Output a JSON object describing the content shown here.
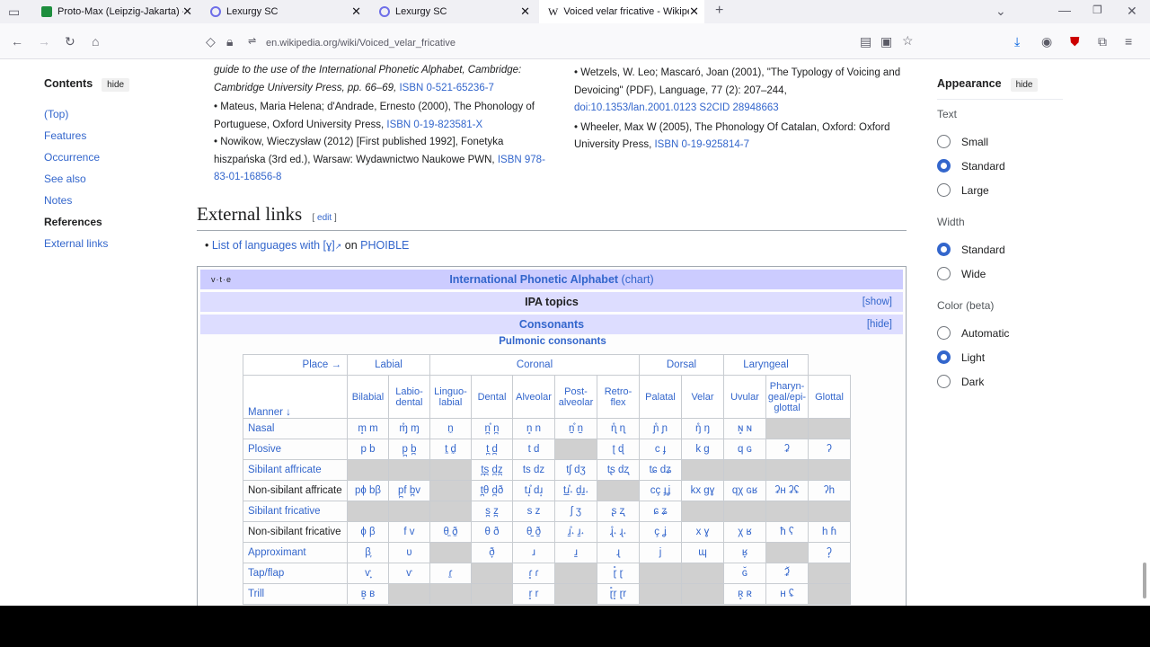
{
  "tabs": [
    {
      "title": "Proto-Max (Leipzig-Jakarta) - G",
      "fav": "#1e8e3e"
    },
    {
      "title": "Lexurgy SC",
      "fav": "#6e6ee8"
    },
    {
      "title": "Lexurgy SC",
      "fav": "#6e6ee8"
    },
    {
      "title": "Voiced velar fricative - Wikipedi",
      "fav": "#000000"
    }
  ],
  "url": "en.wikipedia.org/wiki/Voiced_velar_fricative",
  "toc": {
    "title": "Contents",
    "hide": "hide",
    "items": [
      "(Top)",
      "Features",
      "Occurrence",
      "See also",
      "Notes",
      "References",
      "External links"
    ]
  },
  "references": {
    "left": [
      {
        "text": "guide to the use of the International Phonetic Alphabet, Cambridge: Cambridge University Press, pp. 66–69,",
        "link": "ISBN 0-521-65236-7"
      },
      {
        "text": "Mateus, Maria Helena; d'Andrade, Ernesto (2000), The Phonology of Portuguese, Oxford University Press,",
        "link": "ISBN 0-19-823581-X"
      },
      {
        "text": "Nowikow, Wieczysław (2012) [First published 1992], Fonetyka hiszpańska (3rd ed.), Warsaw: Wydawnictwo Naukowe PWN,",
        "link": "ISBN 978-83-01-16856-8"
      }
    ],
    "right": [
      {
        "text": "Wetzels, W. Leo; Mascaró, Joan (2001), \"The Typology of Voicing and Devoicing\" (PDF), Language, 77 (2): 207–244,",
        "link": "doi:10.1353/lan.2001.0123 S2CID 28948663"
      },
      {
        "text": "Wheeler, Max W (2005), The Phonology Of Catalan, Oxford: Oxford University Press,",
        "link": "ISBN 0-19-925814-7"
      }
    ]
  },
  "external_links": {
    "heading": "External links",
    "edit": "edit",
    "item_link": "List of languages with [ɣ]",
    "item_mid": " on ",
    "item_link2": "PHOIBLE"
  },
  "navbox": {
    "vte": "v·t·e",
    "title_link": "International Phonetic Alphabet",
    "title_paren": "(chart)",
    "topics": "IPA topics",
    "show": "[show]",
    "consonants": "Consonants",
    "hide": "[hide]",
    "pulmonic": "Pulmonic consonants"
  },
  "ipa": {
    "place": "Place →",
    "manner": "Manner ↓",
    "groups": [
      "Labial",
      "Coronal",
      "Dorsal",
      "Laryngeal"
    ],
    "cols": [
      "Bilabial",
      "Labio-dental",
      "Linguo-labial",
      "Dental",
      "Alveolar",
      "Post-alveolar",
      "Retro-flex",
      "Palatal",
      "Velar",
      "Uvular",
      "Pharyn-geal/epi-glottal",
      "Glottal"
    ],
    "rows": [
      {
        "name": "Nasal",
        "link": true,
        "cells": [
          "m̥ m",
          "ɱ̊ ɱ",
          "n̼",
          "n̪̊ n̪",
          "n̥ n",
          "n̠̊ n̠",
          "ɳ̊ ɳ",
          "ɲ̊ ɲ",
          "ŋ̊ ŋ",
          "ɴ̥ ɴ",
          "",
          ""
        ]
      },
      {
        "name": "Plosive",
        "link": true,
        "cells": [
          "p b",
          "p̪ b̪",
          "t̼ d̼",
          "t̪ d̪",
          "t d",
          "",
          "ʈ ɖ",
          "c ɟ",
          "k ɡ",
          "q ɢ",
          "ʡ",
          "ʔ"
        ]
      },
      {
        "name": "Sibilant affricate",
        "link": true,
        "cells": [
          "",
          "",
          "",
          "t̪s̪ d̪z̪",
          "ts dz",
          "tʃ dʒ",
          "tʂ dʐ",
          "tɕ dʑ",
          "",
          "",
          "",
          ""
        ]
      },
      {
        "name": "Non-sibilant affricate",
        "link": false,
        "cells": [
          "pɸ bβ",
          "p̪f b̪v",
          "",
          "t̪θ d̪ð",
          "tɹ̝̊ dɹ̝",
          "t̠ɹ̠̊˔ d̠ɹ̠˔",
          "",
          "cç ɟʝ",
          "kx ɡɣ",
          "qχ ɢʁ",
          "ʡʜ ʡʢ",
          "ʔh"
        ]
      },
      {
        "name": "Sibilant fricative",
        "link": true,
        "cells": [
          "",
          "",
          "",
          "s̪ z̪",
          "s z",
          "ʃ ʒ",
          "ʂ ʐ",
          "ɕ ʑ",
          "",
          "",
          "",
          ""
        ]
      },
      {
        "name": "Non-sibilant fricative",
        "link": false,
        "cells": [
          "ɸ β",
          "f v",
          "θ̼ ð̼",
          "θ ð",
          "θ̠ ð̠",
          "ɹ̠̊˔ ɹ̠˔",
          "ɻ̊˔ ɻ˔",
          "ç ʝ",
          "x ɣ",
          "χ ʁ",
          "ħ ʕ",
          "h ɦ"
        ]
      },
      {
        "name": "Approximant",
        "link": true,
        "cells": [
          "β̞",
          "ʋ",
          "",
          "ð̞",
          "ɹ",
          "ɹ̠",
          "ɻ",
          "j",
          "ɰ",
          "ʁ̞",
          "",
          "ʔ̞"
        ]
      },
      {
        "name": "Tap/flap",
        "link": true,
        "cells": [
          "ⱱ̟",
          "ⱱ",
          "ɾ̼",
          "",
          "ɾ̥ ɾ",
          "",
          "ɽ̊ ɽ",
          "",
          "",
          "ɢ̆",
          "ʡ̆",
          ""
        ]
      },
      {
        "name": "Trill",
        "link": true,
        "cells": [
          "ʙ̥ ʙ",
          "",
          "",
          "",
          "r̥ r",
          "",
          "ɽ̊r̥ ɽr",
          "",
          "",
          "ʀ̥ ʀ",
          "ʜ ʢ",
          ""
        ]
      }
    ]
  },
  "appearance": {
    "title": "Appearance",
    "hide": "hide",
    "text_label": "Text",
    "text_opts": [
      "Small",
      "Standard",
      "Large"
    ],
    "width_label": "Width",
    "width_opts": [
      "Standard",
      "Wide"
    ],
    "color_label": "Color (beta)",
    "color_opts": [
      "Automatic",
      "Light",
      "Dark"
    ]
  }
}
